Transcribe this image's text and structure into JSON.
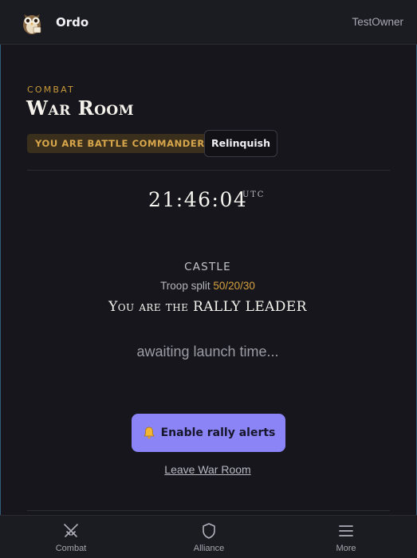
{
  "header": {
    "app_name": "Ordo",
    "user_name": "TestOwner",
    "logo_icon": "owl-logo-icon"
  },
  "section": {
    "label": "COMBAT",
    "title": "War Room"
  },
  "commander": {
    "badge": "YOU ARE BATTLE COMMANDER",
    "relinquish_label": "Relinquish"
  },
  "clock": {
    "time": "21:46:04",
    "timezone": "UTC"
  },
  "rally": {
    "target": "CASTLE",
    "split_label": "Troop split",
    "split_value": "50/20/30",
    "role": "You are the RALLY LEADER",
    "status": "awaiting launch time..."
  },
  "actions": {
    "alerts_icon": "bell-icon",
    "alerts_label": "Enable rally alerts",
    "leave_label": "Leave War Room"
  },
  "nav": {
    "items": [
      {
        "label": "Combat",
        "icon": "crossed-swords-icon"
      },
      {
        "label": "Alliance",
        "icon": "shield-icon"
      },
      {
        "label": "More",
        "icon": "menu-icon"
      }
    ]
  },
  "colors": {
    "background": "#16161c",
    "accent_gold": "#c99a3a",
    "button_purple": "#8a84f7"
  }
}
